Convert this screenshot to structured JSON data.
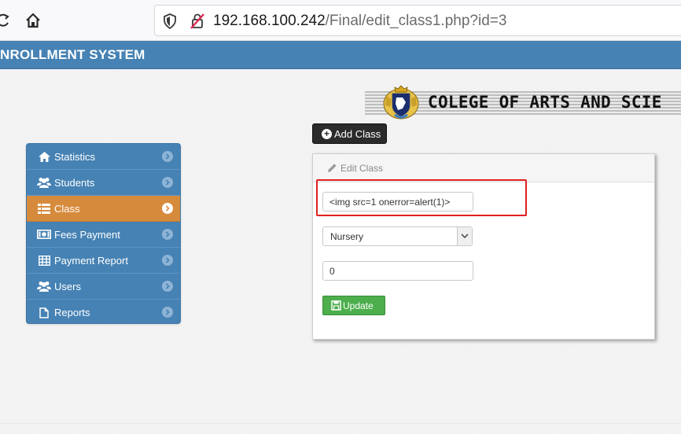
{
  "browser": {
    "url_host": "192.168.100.242",
    "url_path": "/Final/edit_class1.php?id=3"
  },
  "header": {
    "title": "NROLLMENT SYSTEM"
  },
  "banner": {
    "text": "COLEGE OF ARTS AND SCIE"
  },
  "toolbar": {
    "add_class_label": "Add Class"
  },
  "sidebar": {
    "items": [
      {
        "label": "Statistics",
        "icon": "home-icon",
        "active": false
      },
      {
        "label": "Students",
        "icon": "users-icon",
        "active": false
      },
      {
        "label": "Class",
        "icon": "list-icon",
        "active": true
      },
      {
        "label": "Fees Payment",
        "icon": "money-icon",
        "active": false
      },
      {
        "label": "Payment Report",
        "icon": "table-icon",
        "active": false
      },
      {
        "label": "Users",
        "icon": "users-icon",
        "active": false
      },
      {
        "label": "Reports",
        "icon": "file-icon",
        "active": false
      }
    ]
  },
  "panel": {
    "title": "Edit Class",
    "class_name_value": "<img src=1 onerror=alert(1)>",
    "level_value": "Nursery",
    "amount_value": "0",
    "update_label": "Update"
  },
  "colors": {
    "header_blue": "#4682b4",
    "active_orange": "#d68a3c",
    "update_green": "#4cae4c",
    "highlight_red": "#e02020"
  }
}
